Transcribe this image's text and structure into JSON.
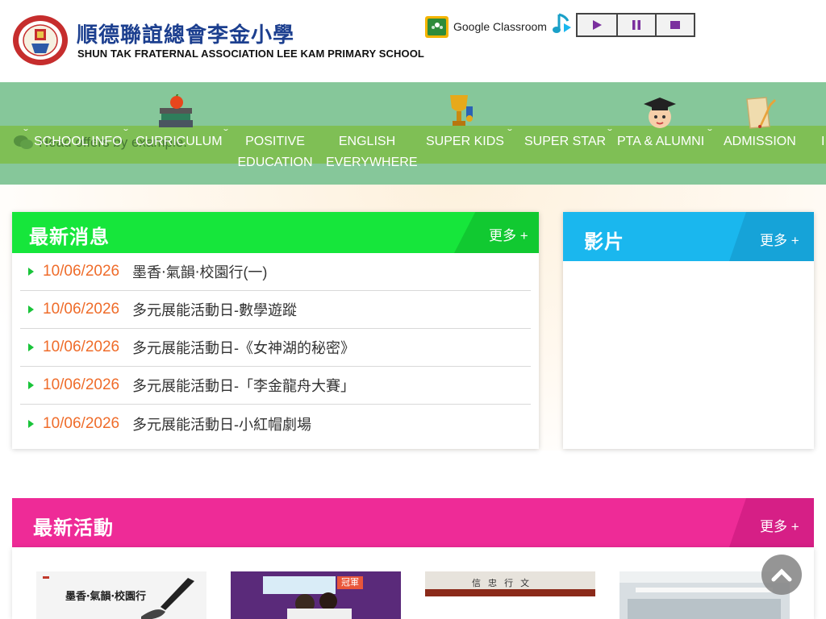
{
  "header": {
    "school_name_zh": "順德聯誼總會李金小學",
    "school_name_en": "SHUN TAK FRATERNAL ASSOCIATION LEE KAM PRIMARY SCHOOL",
    "google_classroom_label": "Google Classroom"
  },
  "player": {
    "buttons": [
      "play-icon",
      "pause-icon",
      "stop-icon"
    ]
  },
  "nav": {
    "ghost_text": "Head offers by example.",
    "items": [
      {
        "label": "SCHOOL INFO"
      },
      {
        "label": "CURRICULUM"
      },
      {
        "label": "POSITIVE",
        "label2": "EDUCATION"
      },
      {
        "label": "ENGLISH",
        "label2": "EVERYWHERE"
      },
      {
        "label": "SUPER KIDS"
      },
      {
        "label": "SUPER STAR"
      },
      {
        "label": "PTA & ALUMNI"
      },
      {
        "label": "ADMISSION"
      },
      {
        "label": "I"
      }
    ]
  },
  "news": {
    "title": "最新消息",
    "more": "更多 +",
    "items": [
      {
        "date": "10/06/2026",
        "title": "墨香‧氣韻‧校園行(一)"
      },
      {
        "date": "10/06/2026",
        "title": "多元展能活動日-數學遊蹤"
      },
      {
        "date": "10/06/2026",
        "title": "多元展能活動日-《女神湖的秘密》"
      },
      {
        "date": "10/06/2026",
        "title": "多元展能活動日-「李金龍舟大賽」"
      },
      {
        "date": "10/06/2026",
        "title": "多元展能活動日-小紅帽劇場"
      }
    ]
  },
  "video": {
    "title": "影片",
    "more": "更多 +"
  },
  "activities": {
    "title": "最新活動",
    "more": "更多 +",
    "thumb1_caption": "墨香‧氣韻‧校園行",
    "thumb2_badge": "冠軍",
    "thumb3_sign": "信 忠 行 文"
  },
  "colors": {
    "news_green": "#16e63b",
    "video_blue": "#1ab7ee",
    "activity_pink": "#ee2b97",
    "date_orange": "#ef6c2a",
    "nav_green": "#7fbf55"
  }
}
